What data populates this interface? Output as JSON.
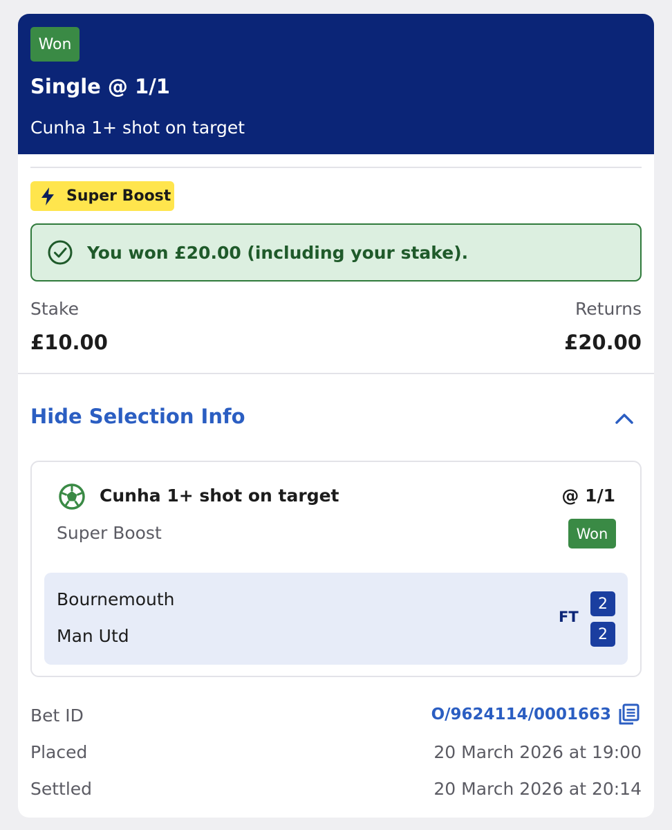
{
  "header": {
    "status": "Won",
    "title": "Single @ 1/1",
    "subtitle": "Cunha 1+ shot on target"
  },
  "boost": {
    "label": "Super Boost",
    "icon": "lightning-icon",
    "color": "#ffe54d"
  },
  "banner": {
    "message": "You won £20.00 (including your stake).",
    "icon": "check-circle-icon"
  },
  "summary": {
    "stake_label": "Stake",
    "stake_value": "£10.00",
    "returns_label": "Returns",
    "returns_value": "£20.00"
  },
  "selection_toggle": {
    "label": "Hide Selection Info",
    "icon": "chevron-up-icon"
  },
  "selection": {
    "icon": "football-icon",
    "name": "Cunha 1+ shot on target",
    "odds": "@ 1/1",
    "type": "Super Boost",
    "status": "Won",
    "match": {
      "home_team": "Bournemouth",
      "away_team": "Man Utd",
      "period": "FT",
      "home_score": "2",
      "away_score": "2"
    }
  },
  "details": {
    "bet_id_label": "Bet ID",
    "bet_id_value": "O/9624114/0001663",
    "copy_icon": "copy-icon",
    "placed_label": "Placed",
    "placed_value": "20 March 2026 at 19:00",
    "settled_label": "Settled",
    "settled_value": "20 March 2026 at 20:14"
  },
  "colors": {
    "header_bg": "#0b2577",
    "won_green": "#3a8a45",
    "link_blue": "#2b5ec2",
    "score_blue": "#1a3ea0"
  }
}
